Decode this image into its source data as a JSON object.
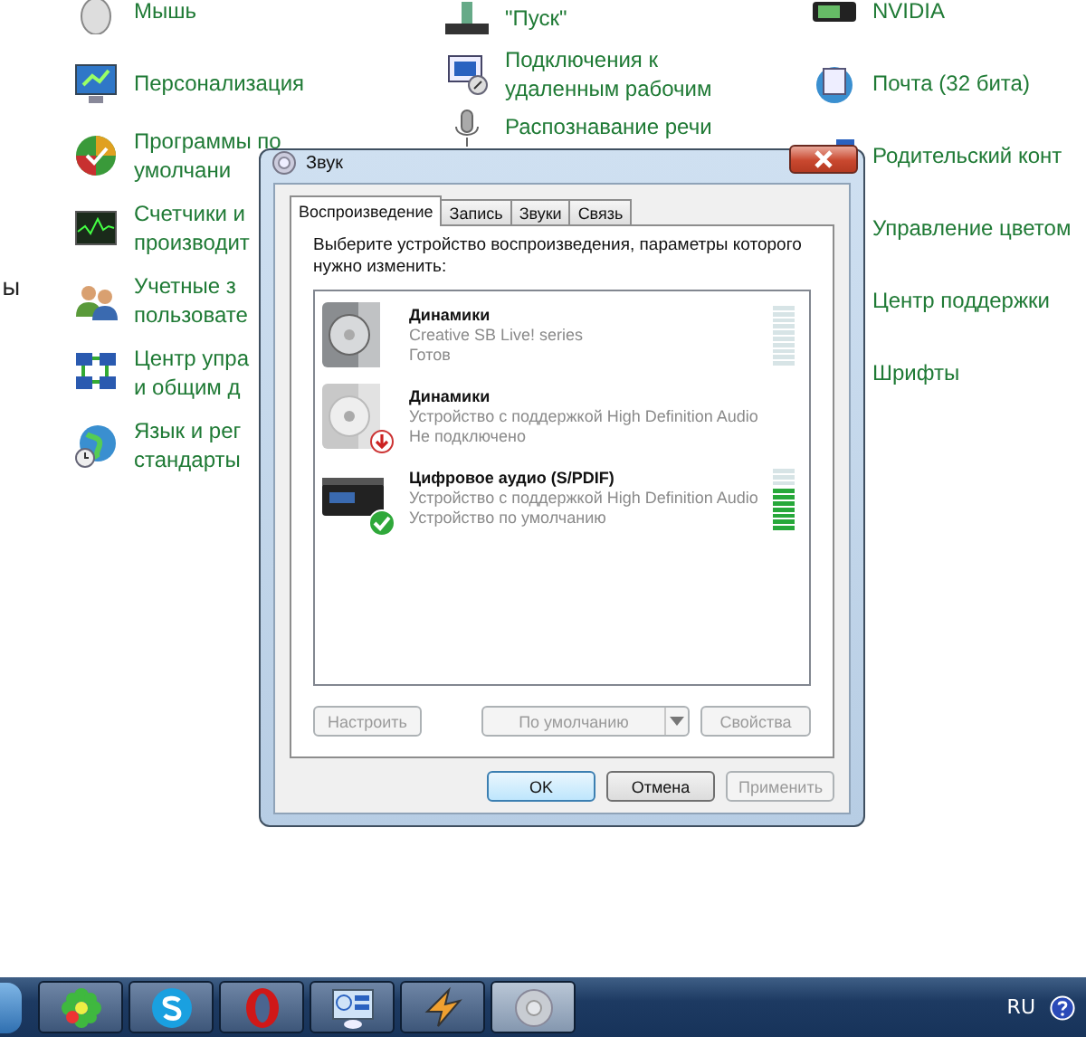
{
  "control_panel": {
    "side_text": "ы",
    "columns": [
      {
        "items": [
          {
            "lines": [
              "Мышь"
            ]
          },
          {
            "lines": [
              "Персонализация"
            ]
          },
          {
            "lines": [
              "Программы по",
              "умолчани"
            ]
          },
          {
            "lines": [
              "Счетчики и",
              "производит"
            ]
          },
          {
            "lines": [
              "Учетные з",
              "пользовате"
            ]
          },
          {
            "lines": [
              "Центр упра",
              "и общим д"
            ]
          },
          {
            "lines": [
              "Язык и рег",
              "стандарты"
            ]
          }
        ]
      },
      {
        "items": [
          {
            "lines": [
              "\"Пуск\""
            ]
          },
          {
            "lines": [
              "Подключения к",
              "удаленным рабочим"
            ]
          },
          {
            "lines": [
              "Распознавание речи"
            ]
          }
        ]
      },
      {
        "items": [
          {
            "lines": [
              "NVIDIA"
            ]
          },
          {
            "lines": [
              "Почта (32 бита)"
            ]
          },
          {
            "lines": [
              "Родительский конт"
            ]
          },
          {
            "lines": [
              "Управление цветом"
            ]
          },
          {
            "lines": [
              "Центр поддержки"
            ]
          },
          {
            "lines": [
              "Шрифты"
            ]
          }
        ]
      }
    ]
  },
  "dialog": {
    "title": "Звук",
    "tabs": [
      {
        "label": "Воспроизведение",
        "selected": true
      },
      {
        "label": "Запись",
        "selected": false
      },
      {
        "label": "Звуки",
        "selected": false
      },
      {
        "label": "Связь",
        "selected": false
      }
    ],
    "instruction": "Выберите устройство воспроизведения, параметры которого нужно изменить:",
    "devices": [
      {
        "kind": "speaker",
        "name": "Динамики",
        "description": "Creative SB Live! series",
        "status": "Готов",
        "disconnected": false,
        "default": false,
        "level": 0
      },
      {
        "kind": "speaker",
        "name": "Динамики",
        "description": "Устройство с поддержкой High Definition Audio",
        "status": "Не подключено",
        "disconnected": true,
        "default": false
      },
      {
        "kind": "digital",
        "name": "Цифровое аудио (S/PDIF)",
        "description": "Устройство с поддержкой High Definition Audio",
        "status": "Устройство по умолчанию",
        "disconnected": false,
        "default": true,
        "level": 0.7
      }
    ],
    "configure_button": {
      "label": "Настроить",
      "disabled": true
    },
    "default_dropdown": {
      "label": "По умолчанию",
      "disabled": true
    },
    "properties_button": {
      "label": "Свойства",
      "disabled": true
    },
    "footer_buttons": [
      {
        "label": "OK",
        "focused": true,
        "disabled": false
      },
      {
        "label": "Отмена",
        "focused": false,
        "disabled": false
      },
      {
        "label": "Применить",
        "focused": false,
        "disabled": true
      }
    ]
  },
  "taskbar": {
    "buttons": [
      {
        "kind": "flower",
        "selected": false
      },
      {
        "kind": "bubble",
        "selected": false
      },
      {
        "kind": "ring",
        "selected": false
      },
      {
        "kind": "gadgets",
        "selected": false
      },
      {
        "kind": "bolt",
        "selected": false
      },
      {
        "kind": "speaker",
        "selected": true
      }
    ],
    "language": "RU"
  }
}
